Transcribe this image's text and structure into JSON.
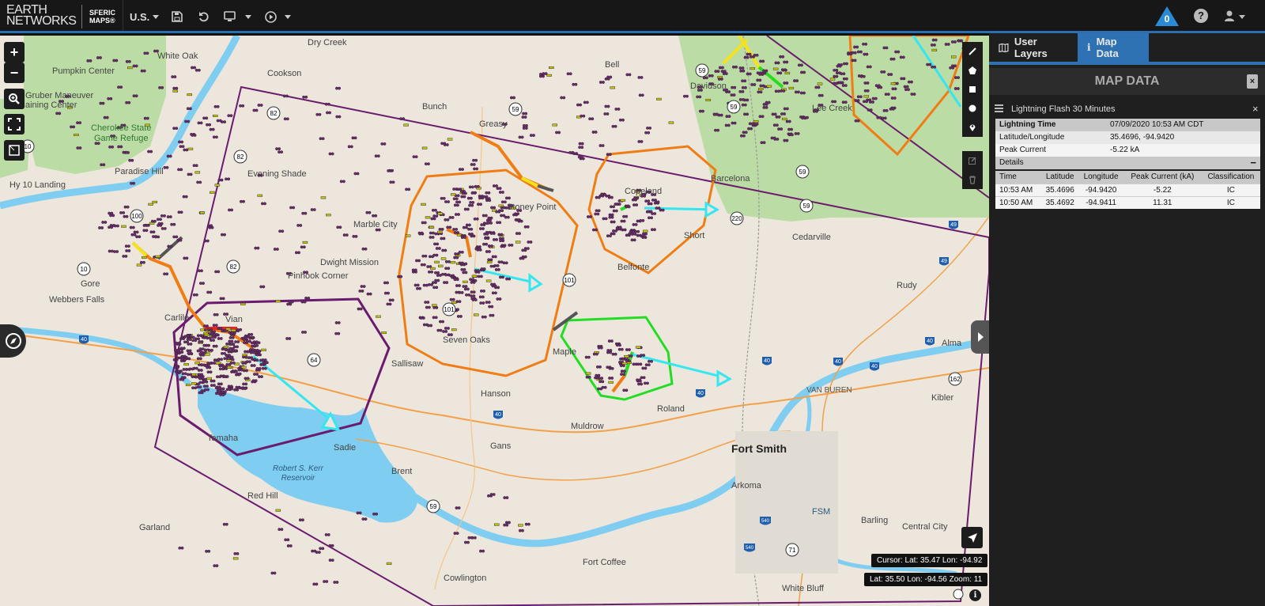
{
  "app": {
    "brand_line1": "EARTH",
    "brand_line2": "NETWORKS",
    "product_line1": "SFERIC",
    "product_line2": "MAPS®",
    "region_label": "U.S.",
    "alert_count": "0"
  },
  "toolbar": {
    "icons": [
      "save-icon",
      "undo-icon",
      "monitor-icon",
      "play-icon",
      "help-icon",
      "user-icon"
    ]
  },
  "panel": {
    "tabs": [
      {
        "label": "User Layers",
        "icon": "map-book-icon",
        "active": false
      },
      {
        "label": "Map Data",
        "icon": "info-icon",
        "active": true
      }
    ],
    "title": "MAP DATA",
    "close_label": "×",
    "layer_name": "Lightning Flash 30 Minutes",
    "layer_close": "×",
    "fields": [
      {
        "key": "Lightning Time",
        "value": "07/09/2020 10:53 AM CDT"
      },
      {
        "key": "Latitude/Longitude",
        "value": "35.4696, -94.9420"
      },
      {
        "key": "Peak Current",
        "value": "-5.22 kA"
      }
    ],
    "details_label": "Details",
    "details_toggle": "−",
    "table": {
      "headers": [
        "Time",
        "Latitude",
        "Longitude",
        "Peak Current (kA)",
        "Classification"
      ],
      "rows": [
        [
          "10:53 AM",
          "35.4696",
          "-94.9420",
          "-5.22",
          "IC"
        ],
        [
          "10:50 AM",
          "35.4692",
          "-94.9411",
          "11.31",
          "IC"
        ]
      ]
    }
  },
  "map": {
    "cursor_readout": "Cursor: Lat: 35.47 Lon: -94.92",
    "center_readout": "Lat: 35.50 Lon: -94.56 Zoom: 11",
    "zoom_in": "+",
    "zoom_out": "−",
    "info_label": "i",
    "places": {
      "dry_creek": "Dry Creek",
      "white_oak": "White Oak",
      "pumpkin_center": "Pumpkin Center",
      "cookson": "Cookson",
      "gruber_1": "Gruber Maneuver",
      "gruber_2": "aining Center",
      "cherokee_1": "Cherokee State",
      "cherokee_2": "Game Refuge",
      "paradise_hill": "Paradise Hill",
      "hy10_landing": "Hy 10 Landing",
      "evening_shade": "Evening Shade",
      "bunch": "Bunch",
      "greasy": "Greasy",
      "bell": "Bell",
      "davidson": "Davidson",
      "lee_creek": "Lee Creek",
      "stoney_point": "Stoney Point",
      "marble_city": "Marble City",
      "dwight_mission": "Dwight Mission",
      "pinhook_corner": "Pinhook Corner",
      "gore": "Gore",
      "webbers_falls": "Webbers Falls",
      "carlile": "Carlile",
      "vian": "Vian",
      "sallisaw": "Sallisaw",
      "seven_oaks": "Seven Oaks",
      "maple": "Maple",
      "belfonte": "Belfonte",
      "short": "Short",
      "cedarville": "Cedarville",
      "rudy": "Rudy",
      "alma": "Alma",
      "kibler": "Kibler",
      "van_buren": "VAN BUREN",
      "hanson": "Hanson",
      "roland": "Roland",
      "muldrow": "Muldrow",
      "gans": "Gans",
      "fort_smith": "Fort Smith",
      "arkoma": "Arkoma",
      "fsm": "FSM",
      "barling": "Barling",
      "central_city": "Central City",
      "brent": "Brent",
      "tamaha": "Tamaha",
      "sadie": "Sadie",
      "kerr_1": "Robert S. Kerr",
      "kerr_2": "Reservoir",
      "red_hill": "Red Hill",
      "garland": "Garland",
      "cowlington": "Cowlington",
      "fort_coffee": "Fort Coffee",
      "white_bluff": "White Bluff",
      "copeland": "Copeland",
      "barcelona": "Barcelona"
    },
    "colors": {
      "storm_purple": "#6a1b6e",
      "cell_orange": "#f07d14",
      "cell_green": "#22dd22",
      "track_cyan": "#33e6f0",
      "water": "#7fcdf0",
      "park": "#b9dba4",
      "strike_fill": "#6e2a6e"
    }
  }
}
